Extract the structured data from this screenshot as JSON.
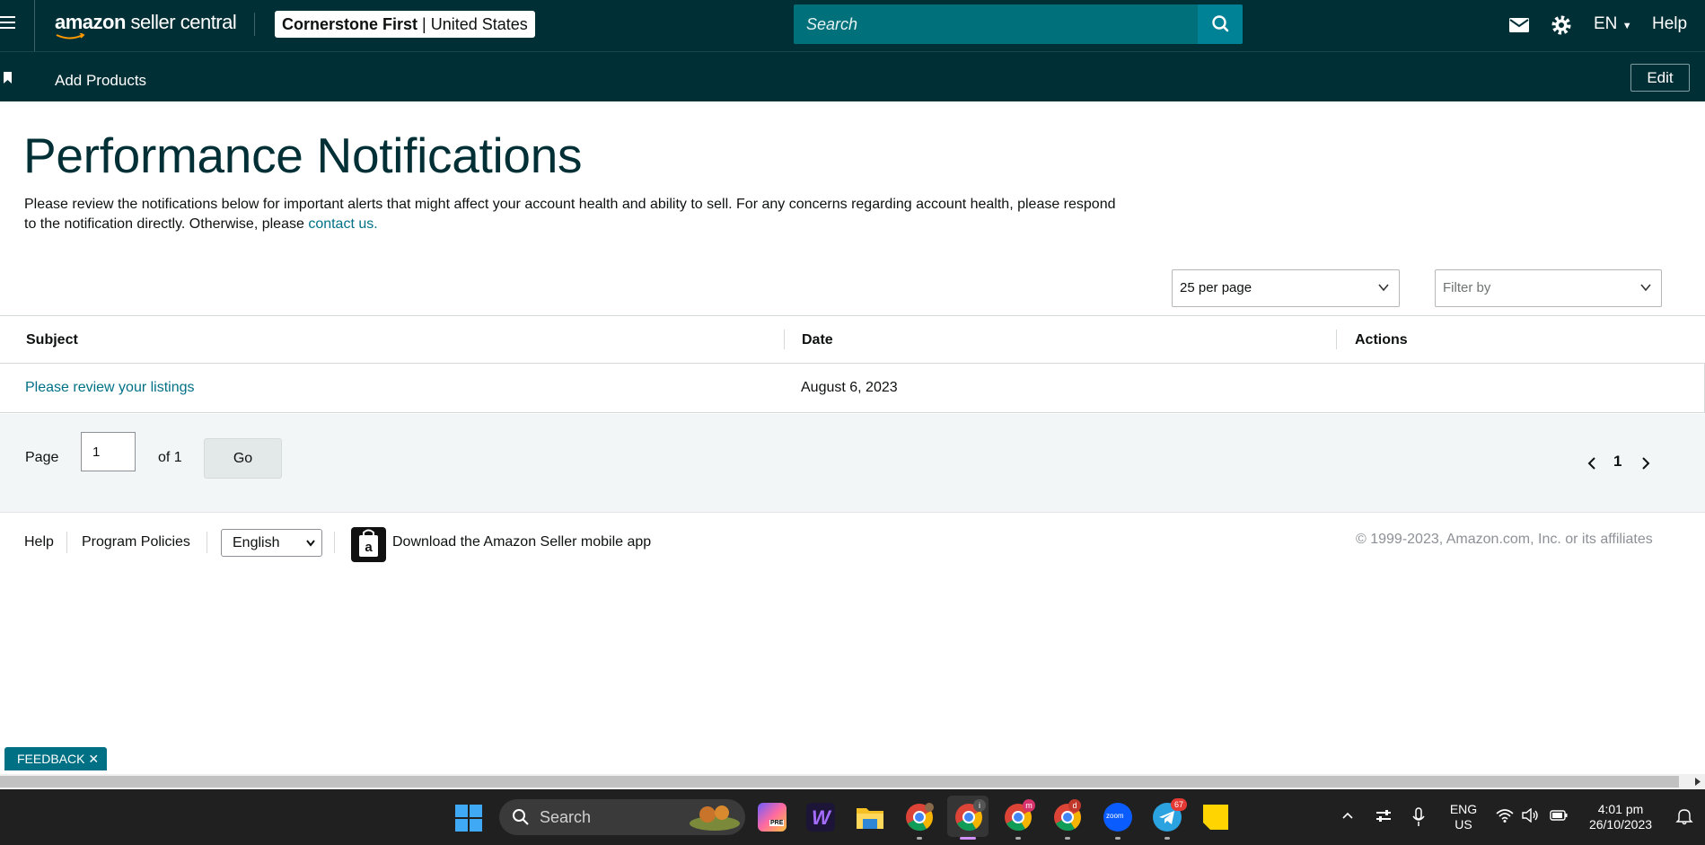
{
  "header": {
    "logo_bold": "amazon",
    "logo_light": " seller central",
    "store_name": "Cornerstone First",
    "store_sep": " | ",
    "store_region": "United States",
    "search_placeholder": "Search",
    "lang": "EN",
    "help": "Help"
  },
  "subnav": {
    "bookmark_item": "Add Products",
    "edit_label": "Edit"
  },
  "page": {
    "title": "Performance Notifications",
    "intro": "Please review the notifications below for important alerts that might affect your account health and ability to sell. For any concerns regarding account health, please respond to the notification directly. Otherwise, please ",
    "contact_link": "contact us."
  },
  "controls": {
    "per_page": "25 per page",
    "filter_placeholder": "Filter by"
  },
  "table": {
    "columns": [
      "Subject",
      "Date",
      "Actions"
    ],
    "rows": [
      {
        "subject": "Please review your listings",
        "date": "August 6, 2023",
        "actions": ""
      }
    ]
  },
  "pagination": {
    "page_label": "Page",
    "page_value": "1",
    "of_label": "of 1",
    "go_label": "Go",
    "current_page": "1"
  },
  "footer": {
    "help": "Help",
    "program_policies": "Program Policies",
    "language_selected": "English",
    "app_text": "Download the Amazon Seller mobile app",
    "copyright": "© 1999-2023, Amazon.com, Inc. or its affiliates"
  },
  "feedback": {
    "label": "FEEDBACK ✕"
  },
  "taskbar": {
    "search_label": "Search",
    "lang_line1": "ENG",
    "lang_line2": "US",
    "time": "4:01 pm",
    "date": "26/10/2023",
    "telegram_badge": "67",
    "chrome_badge_m": "m",
    "chrome_badge_i": "i",
    "chrome_badge_d": "d",
    "zoom_label": "zoom",
    "copilot_tag": "PRE",
    "icons": [
      "windows-start-icon",
      "copilot-icon",
      "w-app-icon",
      "file-explorer-icon",
      "chrome-icon",
      "chrome-icon",
      "chrome-icon",
      "chrome-icon",
      "zoom-icon",
      "telegram-icon",
      "sticky-notes-icon"
    ]
  },
  "colors": {
    "header_bg": "#002f36",
    "link": "#007185",
    "title": "#002f36"
  }
}
